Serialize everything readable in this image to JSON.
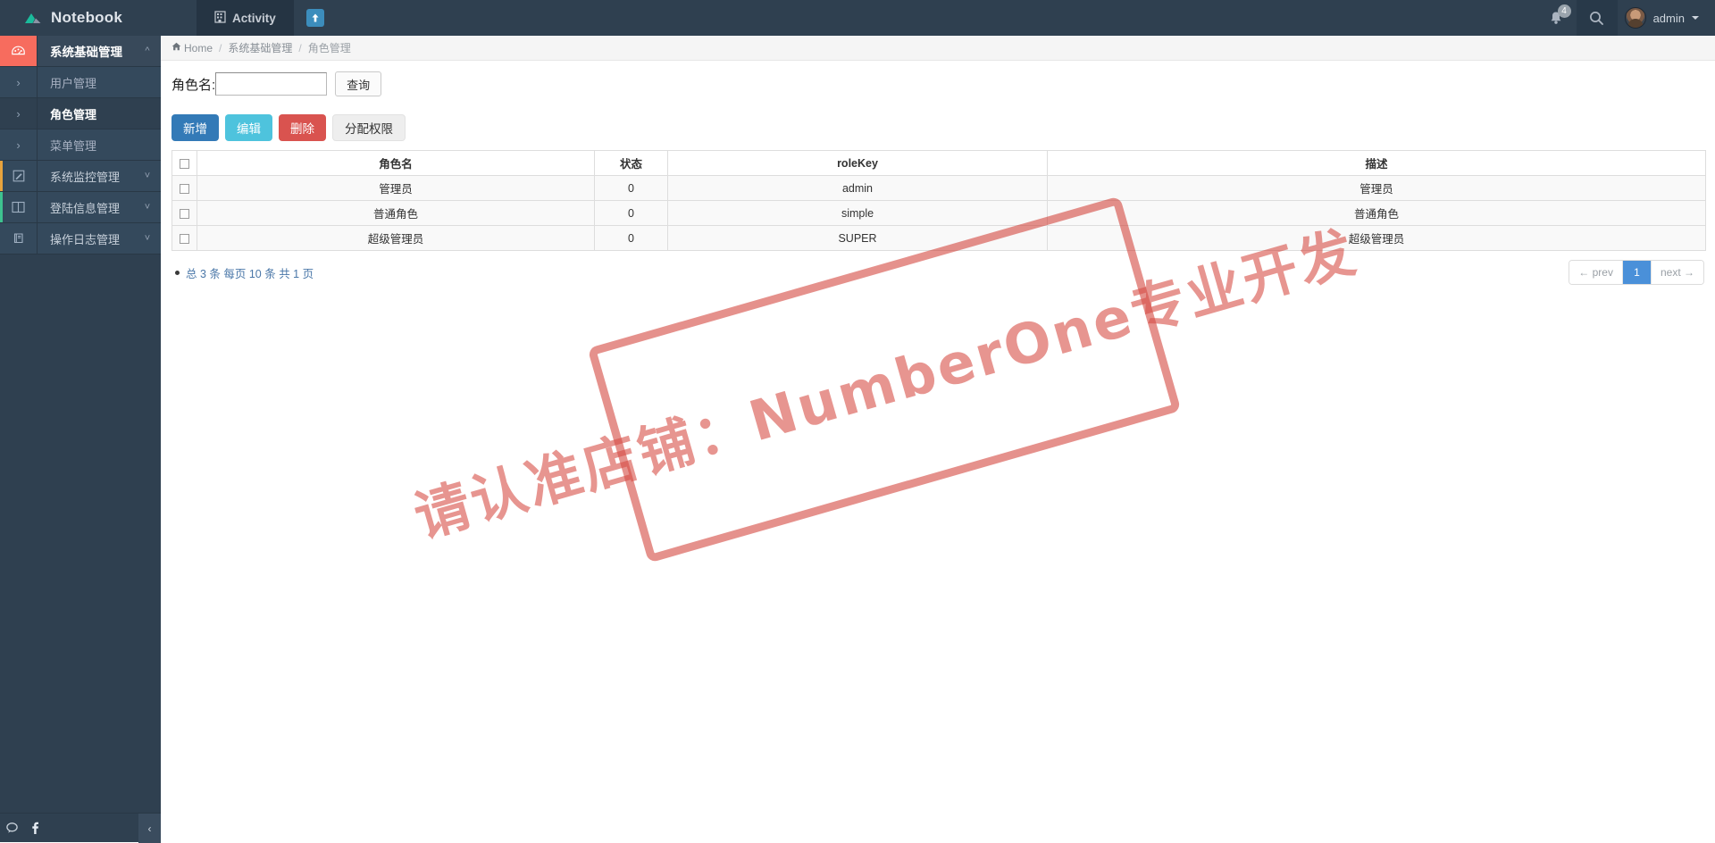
{
  "navbar": {
    "brand": "Notebook",
    "brand_logo_icon": "cloud-logo-icon",
    "tab_label": "Activity",
    "tab_icon": "building-icon",
    "chip_icon": "arrow-up-icon",
    "bell_icon": "bell-icon",
    "bell_badge": "4",
    "search_icon": "search-icon",
    "username": "admin",
    "caret_icon": "chevron-down-icon"
  },
  "sidebar": {
    "items": [
      {
        "label": "系统基础管理",
        "icon": "dashboard-icon",
        "chevron": "chevron-up-icon",
        "state": "active"
      },
      {
        "label": "用户管理",
        "icon": "",
        "chevron": "chevron-right-icon",
        "state": "sub"
      },
      {
        "label": "角色管理",
        "icon": "",
        "chevron": "chevron-right-icon",
        "state": "sub-current"
      },
      {
        "label": "菜单管理",
        "icon": "",
        "chevron": "chevron-right-icon",
        "state": "sub"
      },
      {
        "label": "系统监控管理",
        "icon": "pencil-icon",
        "chevron": "chevron-down-icon",
        "state": "main",
        "accent": "#e8a33d"
      },
      {
        "label": "登陆信息管理",
        "icon": "columns-icon",
        "chevron": "chevron-down-icon",
        "state": "main",
        "accent": "#3ec28f"
      },
      {
        "label": "操作日志管理",
        "icon": "book-icon",
        "chevron": "chevron-down-icon",
        "state": "main",
        "accent": "#2f4050"
      }
    ],
    "bottom": {
      "chat_icon": "chat-bubble-icon",
      "facebook_icon": "facebook-icon",
      "collapse_icon": "chevron-left-icon"
    }
  },
  "breadcrumb": {
    "home_icon": "home-icon",
    "home": "Home",
    "sep": "/",
    "level1": "系统基础管理",
    "level2": "角色管理"
  },
  "search": {
    "label": "角色名:",
    "value": "",
    "placeholder": "",
    "button": "查询"
  },
  "actions": {
    "add": "新增",
    "edit": "编辑",
    "delete": "删除",
    "assign": "分配权限"
  },
  "table": {
    "headers": [
      "",
      "角色名",
      "状态",
      "roleKey",
      "描述"
    ],
    "rows": [
      {
        "name": "管理员",
        "status": "0",
        "roleKey": "admin",
        "desc": "管理员"
      },
      {
        "name": "普通角色",
        "status": "0",
        "roleKey": "simple",
        "desc": "普通角色"
      },
      {
        "name": "超级管理员",
        "status": "0",
        "roleKey": "SUPER",
        "desc": "超级管理员"
      }
    ]
  },
  "footer": {
    "total_text": "总 3 条 每页 10 条 共 1 页",
    "prev": "← prev",
    "page": "1",
    "next": "next →"
  },
  "watermark": {
    "text": "请认准店铺：NumberOne专业开发",
    "color": "#ce2e25"
  }
}
